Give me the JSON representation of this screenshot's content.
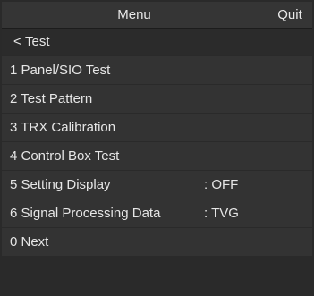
{
  "header": {
    "title": "Menu",
    "quit_label": "Quit"
  },
  "back": {
    "icon": "chevron-left-icon",
    "glyph": "<",
    "label": "Test"
  },
  "items": [
    {
      "label": "1 Panel/SIO Test",
      "value": ""
    },
    {
      "label": "2 Test Pattern",
      "value": ""
    },
    {
      "label": "3 TRX Calibration",
      "value": ""
    },
    {
      "label": "4 Control Box Test",
      "value": ""
    },
    {
      "label": "5 Setting Display",
      "value": ":  OFF"
    },
    {
      "label": "6 Signal Processing Data",
      "value": ":  TVG"
    },
    {
      "label": "0 Next",
      "value": ""
    }
  ],
  "colors": {
    "background": "#2a2a2a",
    "row": "#333333",
    "text": "#e6e6e6"
  }
}
